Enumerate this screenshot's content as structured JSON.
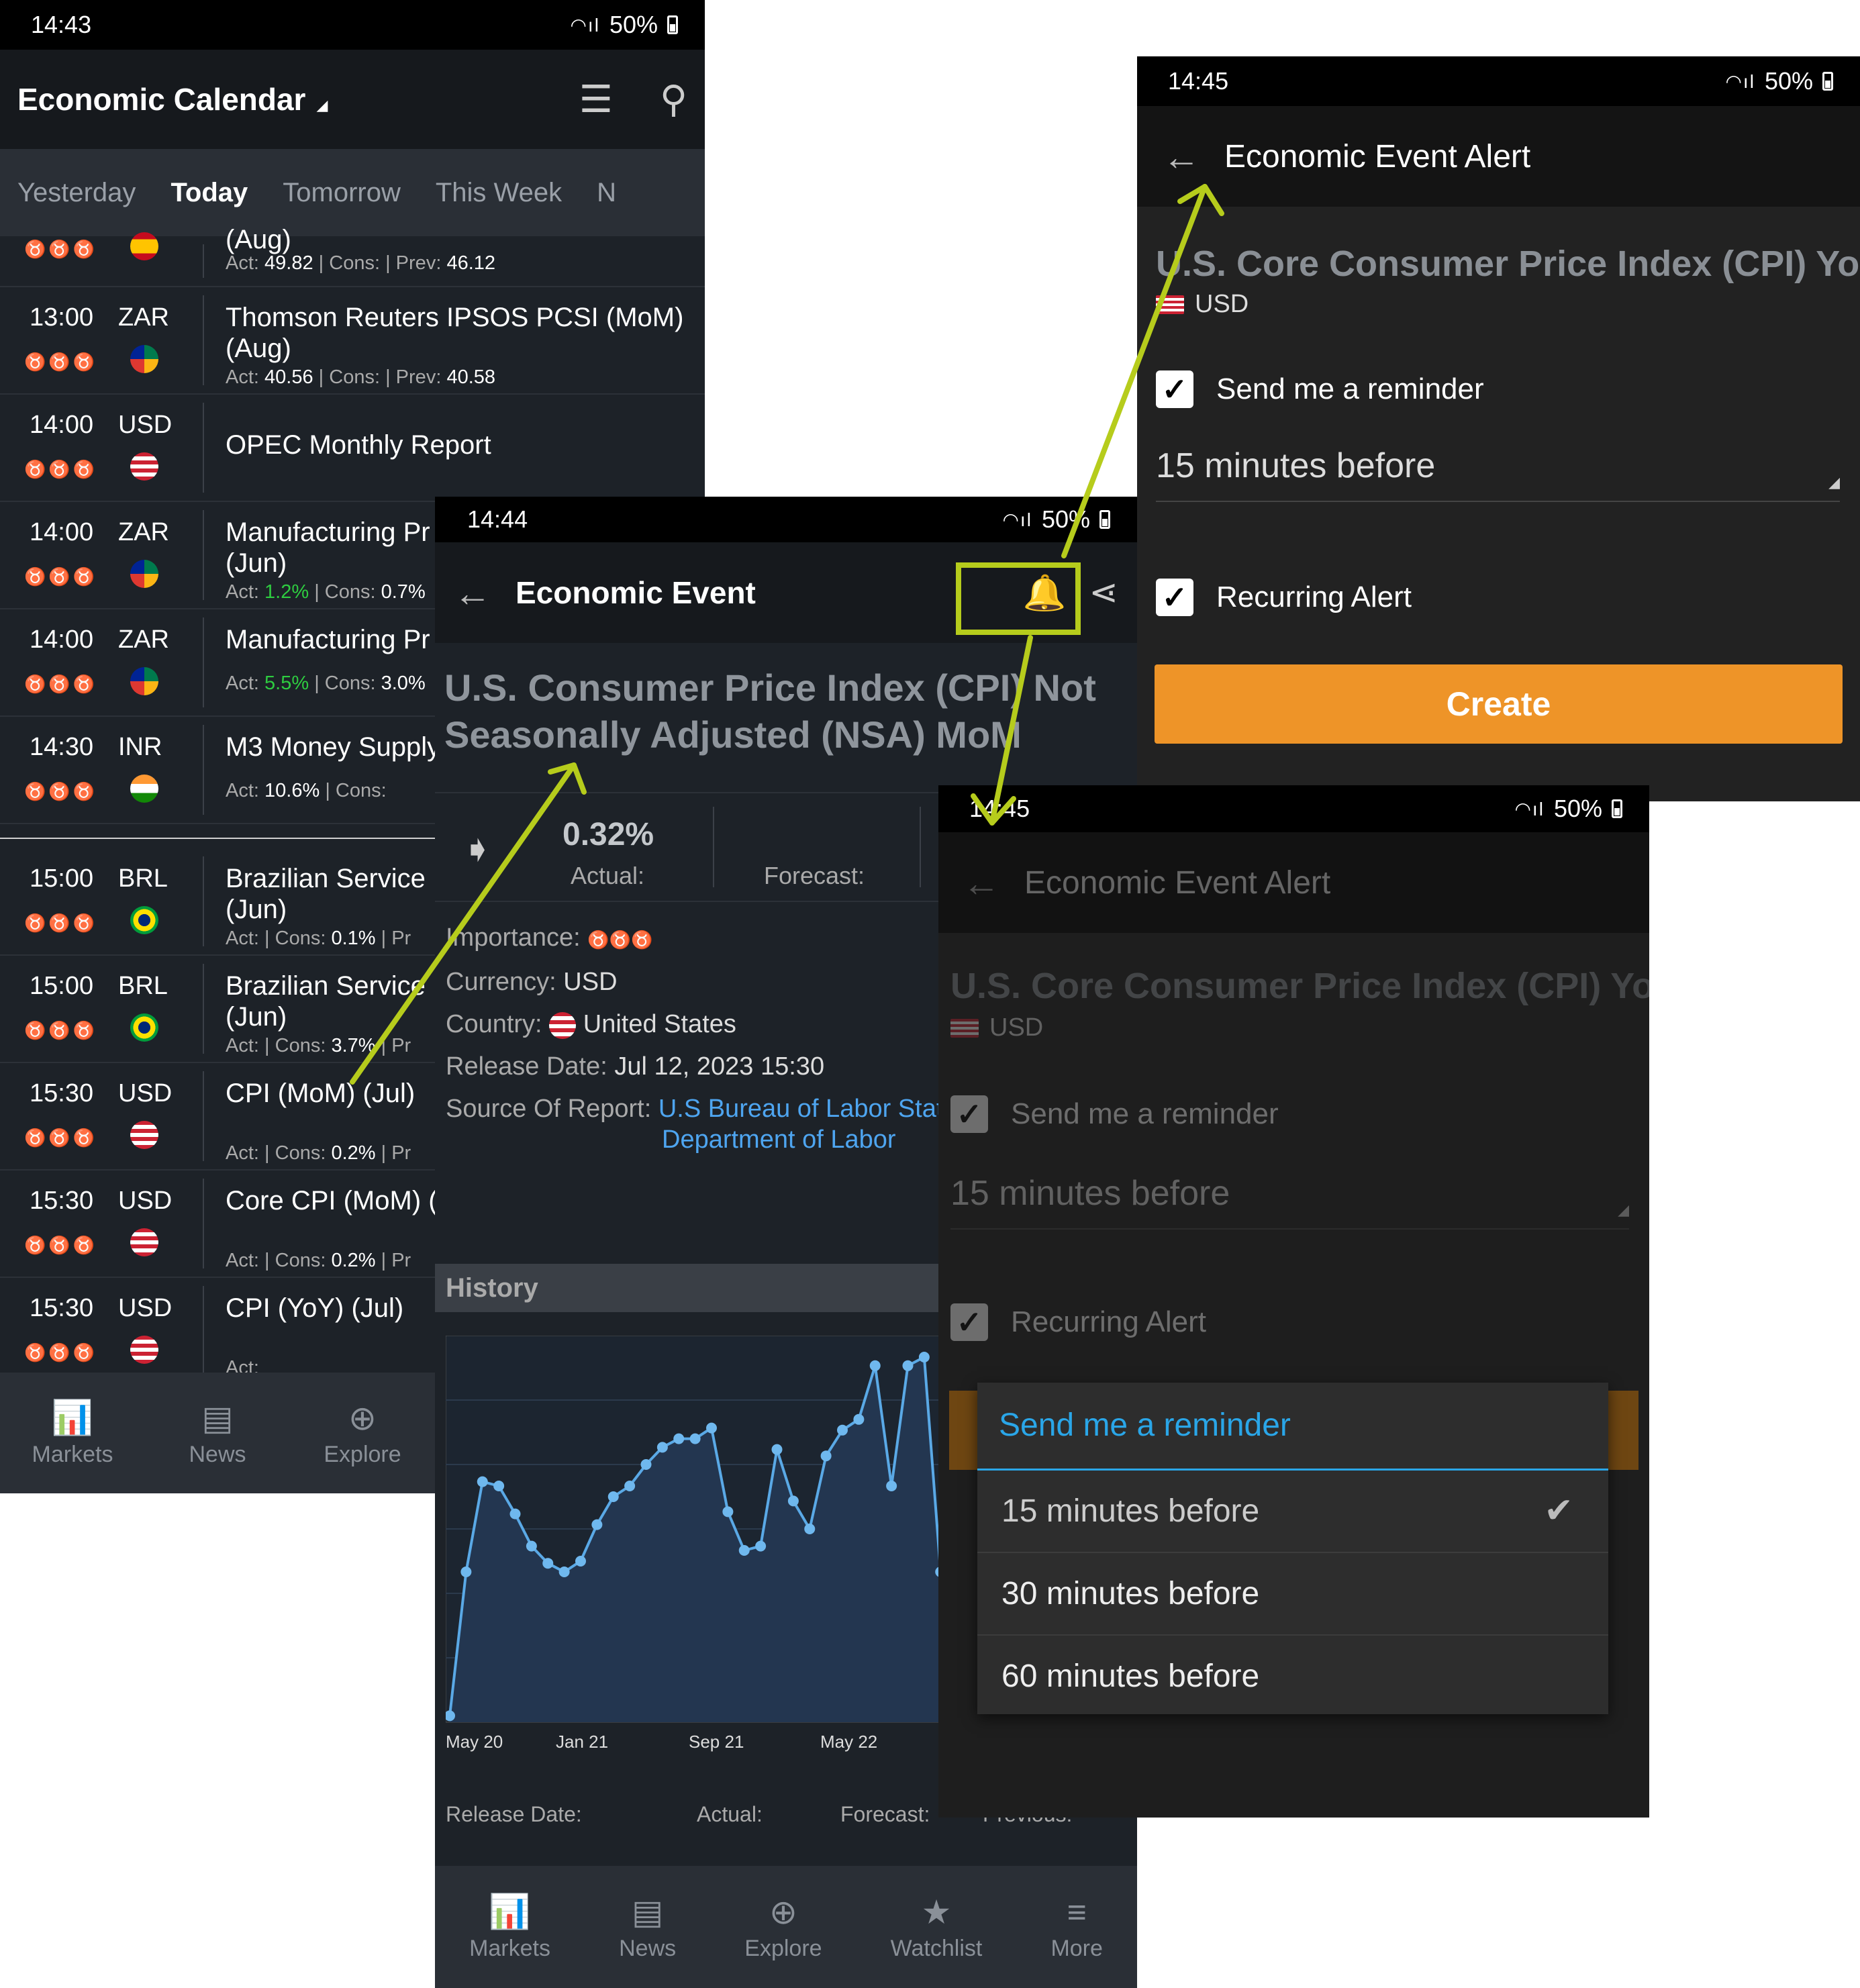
{
  "screen1": {
    "status": {
      "time": "14:43",
      "battery": "50%"
    },
    "title": "Economic Calendar",
    "tabs": [
      "Yesterday",
      "Today",
      "Tomorrow",
      "This Week",
      "N"
    ],
    "rows": [
      {
        "time": "",
        "cur": "",
        "name": "(Aug)",
        "stats": {
          "act": "49.82",
          "cons": "",
          "prev": "46.12"
        }
      },
      {
        "time": "13:00",
        "cur": "ZAR",
        "name": "Thomson Reuters IPSOS PCSI (MoM)\n(Aug)",
        "stats": {
          "act": "40.56",
          "cons": "",
          "prev": "40.58"
        }
      },
      {
        "time": "14:00",
        "cur": "USD",
        "name": "OPEC Monthly Report"
      },
      {
        "time": "14:00",
        "cur": "ZAR",
        "name": "Manufacturing Pr\n(Jun)",
        "stats": {
          "act": "1.2%",
          "cons": "0.7%"
        }
      },
      {
        "time": "14:00",
        "cur": "ZAR",
        "name": "Manufacturing Pr",
        "stats": {
          "act": "5.5%",
          "cons": "3.0%"
        }
      },
      {
        "time": "14:30",
        "cur": "INR",
        "name": "M3 Money Supply",
        "stats": {
          "act": "10.6%",
          "cons": ""
        }
      },
      {
        "time": "15:00",
        "cur": "BRL",
        "name": "Brazilian Service\n(Jun)",
        "stats": {
          "act": "",
          "cons": "0.1%",
          "prev": ""
        }
      },
      {
        "time": "15:00",
        "cur": "BRL",
        "name": "Brazilian Service\n(Jun)",
        "stats": {
          "act": "",
          "cons": "3.7%",
          "prev": ""
        }
      },
      {
        "time": "15:30",
        "cur": "USD",
        "name": "CPI (MoM) (Jul)",
        "stats": {
          "act": "",
          "cons": "0.2%",
          "prev": ""
        }
      },
      {
        "time": "15:30",
        "cur": "USD",
        "name": "Core CPI (MoM) (",
        "stats": {
          "act": "",
          "cons": "0.2%",
          "prev": ""
        }
      },
      {
        "time": "15:30",
        "cur": "USD",
        "name": "CPI (YoY) (Jul)",
        "stats": {
          "act": ""
        }
      }
    ],
    "labels": {
      "act": "Act:",
      "cons": "| Cons:",
      "prev": "| Prev:",
      "pr": "| Pr"
    },
    "nav": [
      "Markets",
      "News",
      "Explore"
    ]
  },
  "screen2": {
    "status": {
      "time": "14:44",
      "battery": "50%"
    },
    "title": "Economic Event",
    "event_title": "U.S. Consumer Price Index (CPI) Not\nSeasonally Adjusted (NSA) MoM",
    "actual_value": "0.32%",
    "actual_label": "Actual:",
    "forecast_label": "Forecast:",
    "importance_label": "Importance:",
    "currency_label": "Currency:",
    "currency_value": "USD",
    "country_label": "Country:",
    "country_value": "United States",
    "release_label": "Release Date:",
    "release_value": "Jul 12, 2023 15:30",
    "source_label": "Source Of Report:",
    "source_value_1": "U.S Bureau of Labor Stat",
    "source_value_2": "Department of Labor",
    "history_label": "History",
    "x_ticks": [
      "May 20",
      "Jan 21",
      "Sep 21",
      "May 22"
    ],
    "hist_cols": [
      "Release Date:",
      "Actual:",
      "Forecast:",
      "Previous:"
    ],
    "nav": [
      "Markets",
      "News",
      "Explore",
      "Watchlist",
      "More"
    ]
  },
  "screen3": {
    "status": {
      "time": "14:45",
      "battery": "50%"
    },
    "title": "Economic Event Alert",
    "event": "U.S. Core Consumer Price Index (CPI) YoY",
    "currency": "USD",
    "reminder_label": "Send me a reminder",
    "reminder_value": "15 minutes before",
    "recurring_label": "Recurring Alert",
    "create_label": "Create"
  },
  "screen4": {
    "status": {
      "time": "14:45",
      "battery": "50%"
    },
    "title": "Economic Event Alert",
    "event": "U.S. Core Consumer Price Index (CPI) YoY",
    "currency": "USD",
    "reminder_label": "Send me a reminder",
    "reminder_value": "15 minutes before",
    "recurring_label": "Recurring Alert",
    "dialog_title": "Send me a reminder",
    "options": [
      "15 minutes before",
      "30 minutes before",
      "60 minutes before"
    ]
  },
  "colors": {
    "annotation": "#b6cc1c",
    "create": "#ee9428",
    "link": "#4ea5f0",
    "green": "#2ecc40"
  },
  "chart_data": {
    "type": "area",
    "x": [
      "May 20",
      "Jan 21",
      "Sep 21",
      "May 22"
    ],
    "values": [
      -0.67,
      0.0,
      0.42,
      0.4,
      0.27,
      0.12,
      0.04,
      0.0,
      0.05,
      0.22,
      0.35,
      0.4,
      0.5,
      0.58,
      0.62,
      0.62,
      0.67,
      0.28,
      0.1,
      0.12,
      0.57,
      0.33,
      0.2,
      0.54,
      0.66,
      0.71,
      0.96,
      0.4,
      0.96,
      1.0,
      0.0,
      -0.01,
      0.12
    ],
    "ylim": [
      -0.7,
      1.1
    ],
    "grid": true
  }
}
